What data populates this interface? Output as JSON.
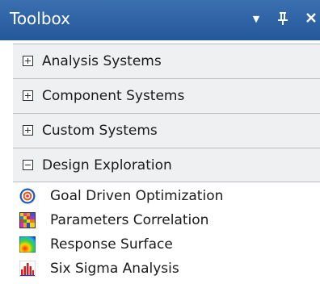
{
  "toolbox": {
    "title": "Toolbox",
    "controls": {
      "dropdown": "▾",
      "pin": "ꟸ",
      "close": "×"
    }
  },
  "categories": [
    {
      "label": "Analysis Systems",
      "state": "collapsed"
    },
    {
      "label": "Component Systems",
      "state": "collapsed"
    },
    {
      "label": "Custom Systems",
      "state": "collapsed"
    },
    {
      "label": "Design Exploration",
      "state": "expanded"
    }
  ],
  "design_exploration_items": [
    {
      "label": "Goal Driven Optimization",
      "icon": "goal-driven-optimization-icon"
    },
    {
      "label": "Parameters Correlation",
      "icon": "parameters-correlation-icon"
    },
    {
      "label": "Response Surface",
      "icon": "response-surface-icon"
    },
    {
      "label": "Six Sigma Analysis",
      "icon": "six-sigma-analysis-icon"
    }
  ]
}
